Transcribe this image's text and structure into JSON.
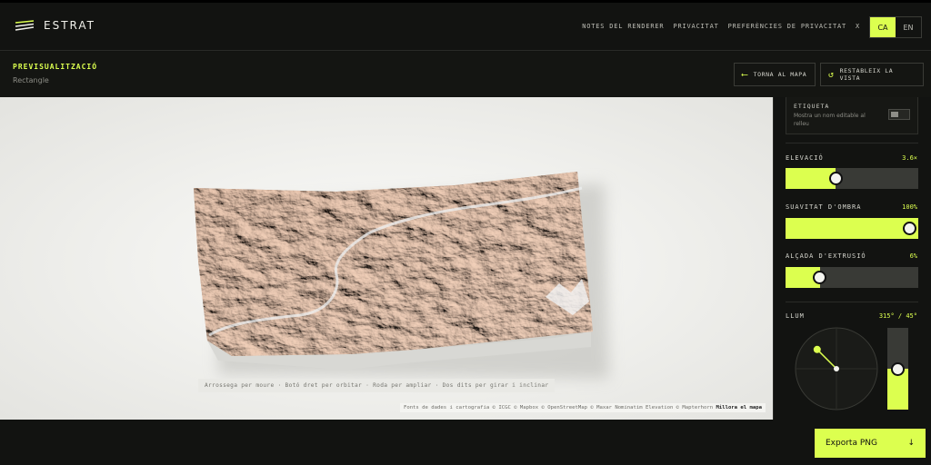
{
  "header": {
    "brand": "ESTRAT",
    "nav": [
      "NOTES DEL RENDERER",
      "PRIVACITAT",
      "PREFERÈNCIES DE PRIVACITAT",
      "X"
    ],
    "languages": [
      {
        "label": "CA",
        "active": true
      },
      {
        "label": "EN",
        "active": false
      }
    ]
  },
  "subheader": {
    "title": "PREVISUALITZACIÓ",
    "subtitle": "Rectangle",
    "back_label": "TORNA AL MAPA",
    "reset_label": "RESTABLEIX LA VISTA"
  },
  "viewport": {
    "hint": "Arrossega per moure · Botó dret per orbitar · Roda per ampliar · Dos dits per girar i inclinar",
    "attribution": "Fonts de dades i cartografia © ICGC © Mapbox © OpenStreetMap © Maxar Nominatim Elevation © Mapterhorn",
    "attribution_link": "Millora el mapa"
  },
  "panel": {
    "label_card": {
      "title": "ETIQUETA",
      "description": "Mostra un nom editable al relleu",
      "enabled": false
    },
    "elevation": {
      "label": "ELEVACIÓ",
      "value_text": "3.6×",
      "fraction": 0.38
    },
    "shade": {
      "label": "SUAVITAT D'OMBRA",
      "value_text": "100%",
      "fraction": 1.0
    },
    "extrusion": {
      "label": "ALÇADA D'EXTRUSIÓ",
      "value_text": "6%",
      "fraction": 0.26
    },
    "light": {
      "label": "LLUM",
      "value_text": "315° / 45°",
      "azimuth_deg": 315,
      "altitude_deg": 45,
      "altitude_fraction": 0.5
    }
  },
  "footer": {
    "export_label": "Exporta PNG",
    "export_icon": "download-arrow-icon"
  },
  "colors": {
    "accent": "#dcff4f",
    "background": "#121311",
    "terrain": "#d7ac90"
  }
}
